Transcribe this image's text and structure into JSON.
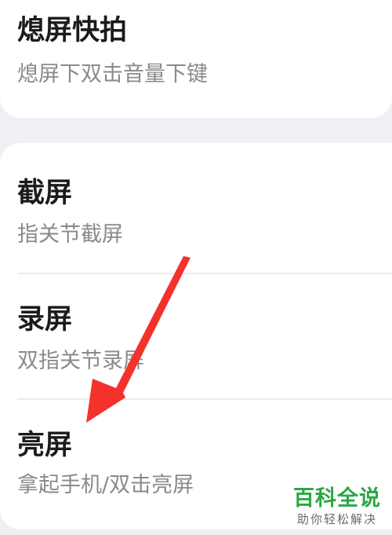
{
  "items": [
    {
      "title": "熄屏快拍",
      "subtitle": "熄屏下双击音量下键"
    },
    {
      "title": "截屏",
      "subtitle": "指关节截屏"
    },
    {
      "title": "录屏",
      "subtitle": "双指关节录屏"
    },
    {
      "title": "亮屏",
      "subtitle": "拿起手机/双击亮屏"
    }
  ],
  "annotation": {
    "icon": "red-arrow-icon",
    "color": "#f2322b"
  },
  "watermark": {
    "main": "百科全说",
    "sub": "助你轻松解决",
    "color": "#29a843"
  }
}
